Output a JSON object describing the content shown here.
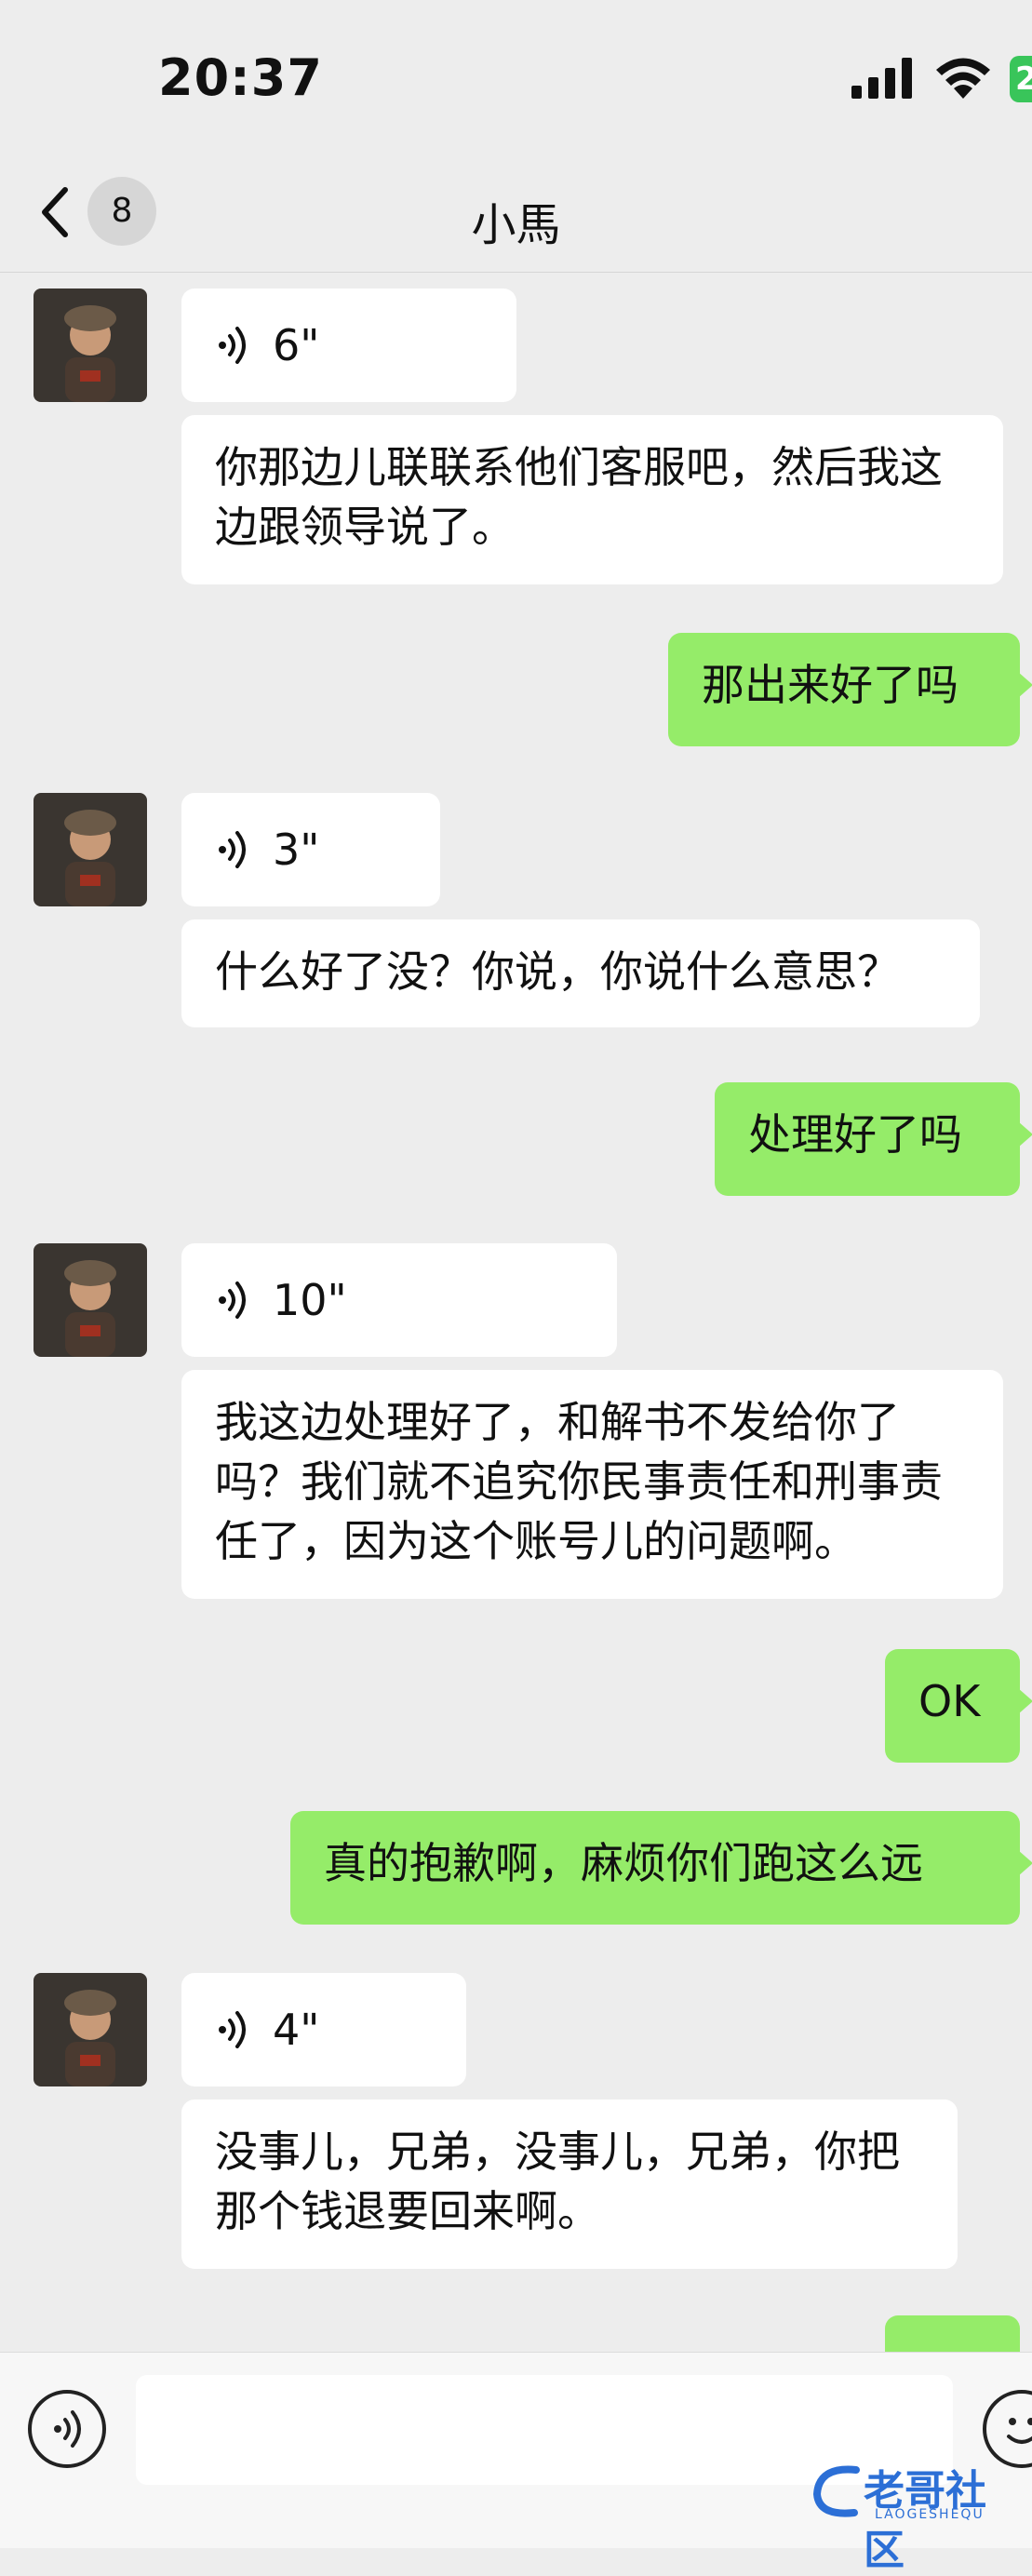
{
  "status_bar": {
    "time": "20:37",
    "battery": "2"
  },
  "nav": {
    "unread_count": "8",
    "title": "小馬"
  },
  "messages": [
    {
      "voice_duration": "6\"",
      "text": "你那边儿联联系他们客服吧，然后我这边跟领导说了。"
    },
    {
      "out_text": "那出来好了吗"
    },
    {
      "voice_duration": "3\"",
      "text": "什么好了没？你说，你说什么意思？"
    },
    {
      "out_text": "处理好了吗"
    },
    {
      "voice_duration": "10\"",
      "text": "我这边处理好了，和解书不发给你了吗？我们就不追究你民事责任和刑事责任了，因为这个账号儿的问题啊。"
    },
    {
      "out_text": "OK"
    },
    {
      "out_text": "真的抱歉啊，麻烦你们跑这么远"
    },
    {
      "voice_duration": "4\"",
      "text": "没事儿，兄弟，没事儿，兄弟，你把那个钱退要回来啊。"
    }
  ],
  "input": {
    "placeholder": ""
  },
  "watermark": {
    "text": "老哥社区",
    "sub": "LAOGESHEQU"
  },
  "colors": {
    "outgoing_bubble": "#95ec69",
    "incoming_bubble": "#ffffff",
    "background": "#ededed"
  }
}
